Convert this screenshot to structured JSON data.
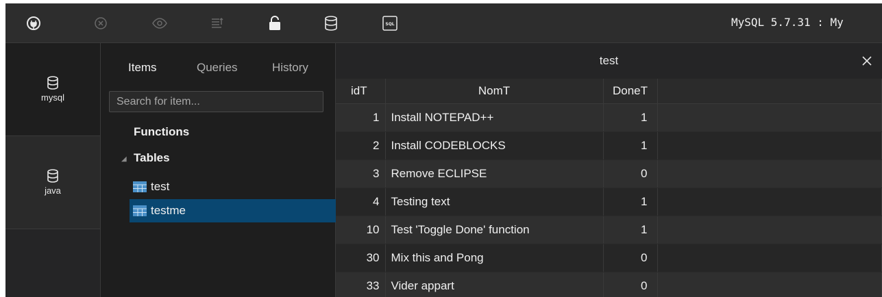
{
  "toolbar": {
    "connection_label": "MySQL 5.7.31 : My",
    "icons": [
      "plug-icon",
      "circle-x-icon",
      "eye-icon",
      "sort-lines-icon",
      "unlock-icon",
      "database-icon",
      "sql-file-icon"
    ],
    "sql_badge": "SQL"
  },
  "databases": [
    {
      "name": "mysql"
    },
    {
      "name": "java"
    }
  ],
  "items_panel": {
    "tabs": [
      {
        "label": "Items"
      },
      {
        "label": "Queries"
      },
      {
        "label": "History"
      }
    ],
    "search": {
      "placeholder": "Search for item...",
      "value": ""
    },
    "functions_label": "Functions",
    "tables_label": "Tables",
    "tables": [
      {
        "name": "test"
      },
      {
        "name": "testme"
      }
    ]
  },
  "result": {
    "title": "test",
    "columns": [
      "idT",
      "NomT",
      "DoneT"
    ],
    "rows": [
      [
        "1",
        "Install NOTEPAD++",
        "1"
      ],
      [
        "2",
        "Install CODEBLOCKS",
        "1"
      ],
      [
        "3",
        "Remove ECLIPSE",
        "0"
      ],
      [
        "4",
        "Testing text",
        "1"
      ],
      [
        "10",
        "Test 'Toggle Done' function",
        "1"
      ],
      [
        "30",
        "Mix this and Pong",
        "0"
      ],
      [
        "33",
        "Vider appart",
        "0"
      ]
    ]
  },
  "colors": {
    "selection": "#094771",
    "background": "#1e1e1e",
    "panel": "#252526"
  }
}
